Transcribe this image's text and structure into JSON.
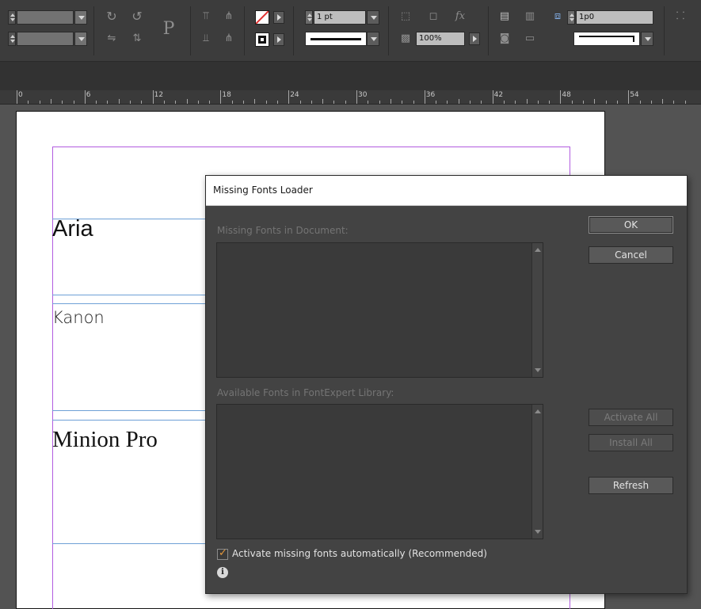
{
  "toolbar": {
    "stroke_weight": "1 pt",
    "opacity": "100%",
    "ref_size": "1p0",
    "icons": [
      "rotate-cw-icon",
      "rotate-ccw-icon",
      "paragraph-p-icon",
      "flip-horizontal-icon",
      "flip-vertical-icon",
      "align-top-icon",
      "distribute-icon",
      "fill-none-icon",
      "stroke-swatch-icon",
      "effects-fx-icon",
      "text-wrap-icon",
      "frame-fitting-icon"
    ]
  },
  "ruler": {
    "labels": [
      "0",
      "6",
      "12",
      "18",
      "24",
      "30",
      "36",
      "42",
      "48",
      "54"
    ]
  },
  "page": {
    "font_samples": [
      "Aria",
      "Kanon",
      "Minion Pro"
    ]
  },
  "dialog": {
    "title": "Missing Fonts Loader",
    "missing_label": "Missing Fonts in Document:",
    "available_label": "Available Fonts in FontExpert Library:",
    "ok": "OK",
    "cancel": "Cancel",
    "activate_all": "Activate All",
    "install_all": "Install All",
    "refresh": "Refresh",
    "auto_activate_label": "Activate missing fonts automatically (Recommended)",
    "auto_activate_checked": true,
    "check_glyph": "✓",
    "info_glyph": "i"
  },
  "colors": {
    "accent_check": "#e3973b",
    "margin_guide": "#b25ce0",
    "frame_edge": "#6ea0d6",
    "fill_none_slash": "#e03030"
  }
}
